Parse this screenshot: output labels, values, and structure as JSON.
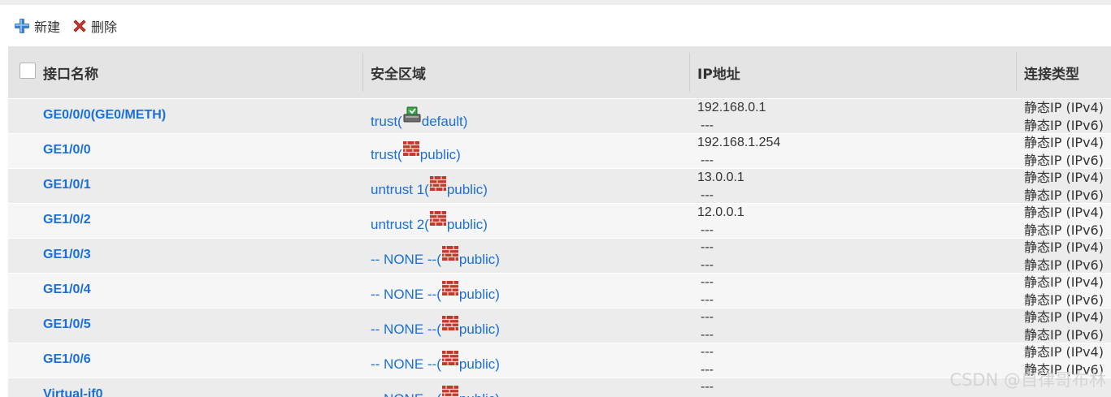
{
  "toolbar": {
    "new_label": "新建",
    "delete_label": "删除"
  },
  "columns": {
    "name": "接口名称",
    "zone": "安全区域",
    "ip": "IP地址",
    "conn": "连接类型"
  },
  "rows": [
    {
      "name": "GE0/0/0(GE0/METH)",
      "zone_prefix": "trust(",
      "zone_suffix": " default)",
      "zone_icon": "vsys-default-icon",
      "ip_v4": "192.168.0.1",
      "ip_v6": "---",
      "conn_v4": "静态IP (IPv4)",
      "conn_v6": "静态IP (IPv6)"
    },
    {
      "name": "GE1/0/0",
      "zone_prefix": "trust(",
      "zone_suffix": " public)",
      "zone_icon": "firewall-icon",
      "ip_v4": "192.168.1.254",
      "ip_v6": "---",
      "conn_v4": "静态IP (IPv4)",
      "conn_v6": "静态IP (IPv6)"
    },
    {
      "name": "GE1/0/1",
      "zone_prefix": "untrust 1(",
      "zone_suffix": " public)",
      "zone_icon": "firewall-icon",
      "ip_v4": "13.0.0.1",
      "ip_v6": "---",
      "conn_v4": "静态IP (IPv4)",
      "conn_v6": "静态IP (IPv6)"
    },
    {
      "name": "GE1/0/2",
      "zone_prefix": "untrust 2(",
      "zone_suffix": " public)",
      "zone_icon": "firewall-icon",
      "ip_v4": "12.0.0.1",
      "ip_v6": "---",
      "conn_v4": "静态IP (IPv4)",
      "conn_v6": "静态IP (IPv6)"
    },
    {
      "name": "GE1/0/3",
      "zone_prefix": "-- NONE --(",
      "zone_suffix": " public)",
      "zone_icon": "firewall-icon",
      "ip_v4": "---",
      "ip_v6": "---",
      "conn_v4": "静态IP (IPv4)",
      "conn_v6": "静态IP (IPv6)"
    },
    {
      "name": "GE1/0/4",
      "zone_prefix": "-- NONE --(",
      "zone_suffix": " public)",
      "zone_icon": "firewall-icon",
      "ip_v4": "---",
      "ip_v6": "---",
      "conn_v4": "静态IP (IPv4)",
      "conn_v6": "静态IP (IPv6)"
    },
    {
      "name": "GE1/0/5",
      "zone_prefix": "-- NONE --(",
      "zone_suffix": " public)",
      "zone_icon": "firewall-icon",
      "ip_v4": "---",
      "ip_v6": "---",
      "conn_v4": "静态IP (IPv4)",
      "conn_v6": "静态IP (IPv6)"
    },
    {
      "name": "GE1/0/6",
      "zone_prefix": "-- NONE --(",
      "zone_suffix": " public)",
      "zone_icon": "firewall-icon",
      "ip_v4": "---",
      "ip_v6": "---",
      "conn_v4": "静态IP (IPv4)",
      "conn_v6": "静态IP (IPv6)"
    },
    {
      "name": "Virtual-if0",
      "zone_prefix": "-- NONE --(",
      "zone_suffix": " public)",
      "zone_icon": "firewall-icon",
      "ip_v4": "---",
      "ip_v6": "",
      "conn_v4": "",
      "conn_v6": ""
    }
  ],
  "watermark": "CSDN @自律哥布林",
  "colors": {
    "link": "#1a6fd8",
    "header_bg": "#e4e4e4",
    "row_light": "#f6f6f6",
    "row_dark": "#ececec",
    "firewall": "#c0392b"
  }
}
